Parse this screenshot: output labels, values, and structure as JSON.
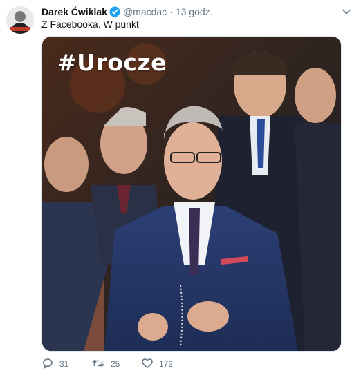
{
  "tweet": {
    "display_name": "Darek Ćwiklak",
    "verified": true,
    "handle": "@macdac",
    "separator": "·",
    "time": "13 godz.",
    "text": "Z Facebooka. W punkt",
    "media": {
      "overlay_text": "#Urocze"
    },
    "actions": {
      "reply_icon": "reply-icon",
      "reply_count": "31",
      "retweet_icon": "retweet-icon",
      "retweet_count": "25",
      "like_icon": "heart-icon",
      "like_count": "172"
    }
  },
  "colors": {
    "verified": "#1da1f2",
    "secondary_text": "#657786",
    "primary_text": "#14171a"
  }
}
